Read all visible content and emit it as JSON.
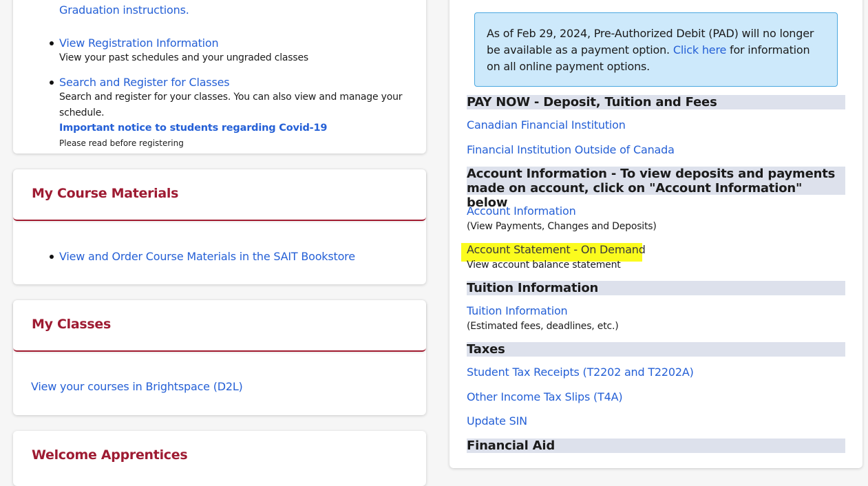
{
  "registration_card": {
    "graduation_tail": "Graduation instructions.",
    "items": [
      {
        "label": "View Registration Information",
        "desc": "View your past schedules and your ungraded classes"
      },
      {
        "label": "Search and Register for Classes",
        "desc": "Search and register for your classes. You can also view and manage your schedule.",
        "notice": "Important notice to students regarding Covid-19",
        "notice_sub": "Please read before registering"
      }
    ]
  },
  "course_materials_card": {
    "title": "My Course Materials",
    "items": [
      {
        "label": "View and Order Course Materials in the SAIT Bookstore"
      }
    ]
  },
  "classes_card": {
    "title": "My Classes",
    "link": "View your courses in Brightspace (D2L)"
  },
  "apprentices_card": {
    "title": "Welcome Apprentices"
  },
  "alert": {
    "text_before": "As of Feb 29, 2024, Pre-Authorized Debit (PAD) will no longer be available as a payment option.",
    "link": "Click here",
    "text_after": "for information on all online payment options."
  },
  "pay_now": {
    "heading": "PAY NOW - Deposit, Tuition and Fees",
    "links": [
      "Canadian Financial Institution",
      "Financial Institution Outside of Canada"
    ]
  },
  "account_info": {
    "heading": "Account Information - To view deposits and payments made on account, click on \"Account Information\" below",
    "link": "Account Information",
    "link_desc": "(View Payments, Changes and Deposits)",
    "statement_link": "Account Statement - On Demand",
    "statement_desc": "View account balance statement"
  },
  "tuition_info": {
    "heading": "Tuition Information",
    "link": "Tuition Information",
    "link_desc": "(Estimated fees, deadlines, etc.)"
  },
  "taxes": {
    "heading": "Taxes",
    "links": [
      "Student Tax Receipts (T2202 and T2202A)",
      "Other Income Tax Slips (T4A)",
      "Update SIN"
    ]
  },
  "financial_aid": {
    "heading": "Financial Aid"
  },
  "colors": {
    "link": "#2560d6",
    "card_title": "#9e1b32",
    "section_bg": "#dde1ec",
    "alert_bg": "#cde9fb",
    "highlight": "#fbfb1e"
  }
}
